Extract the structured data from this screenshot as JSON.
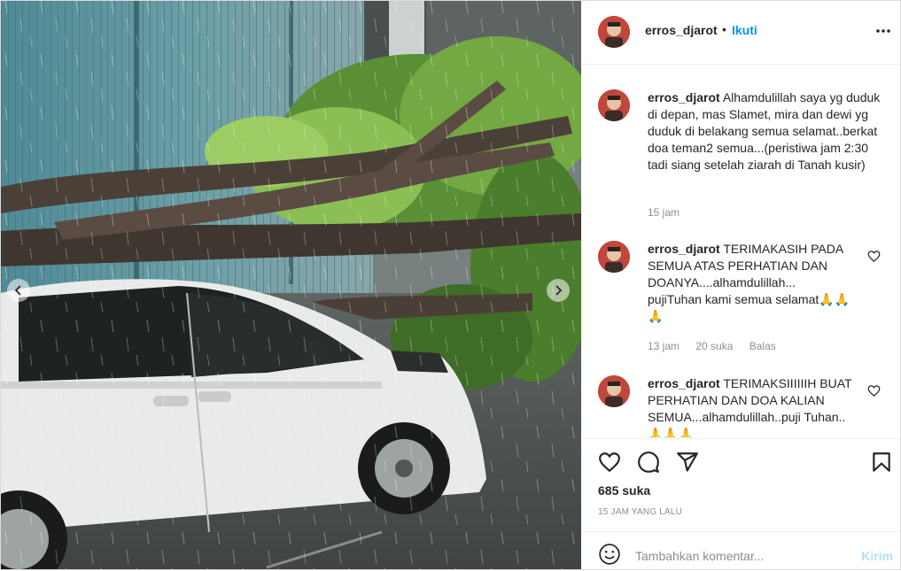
{
  "header": {
    "username": "erros_djarot",
    "separator": "•",
    "follow_label": "Ikuti"
  },
  "icons": {
    "more": "more-horizontal-icon",
    "like": "heart-icon",
    "comment": "comment-icon",
    "share": "paper-plane-icon",
    "save": "bookmark-icon",
    "emoji": "smiley-icon",
    "carousel_prev": "chevron-left-icon",
    "carousel_next": "chevron-right-icon"
  },
  "comments": [
    {
      "username": "erros_djarot",
      "text": "Alhamdulillah saya yg duduk di depan, mas Slamet, mira dan dewi yg duduk di belakang semua selamat..berkat doa teman2 semua...(peristiwa jam 2:30 tadi siang setelah ziarah di Tanah kusir)",
      "time": "15 jam"
    },
    {
      "username": "erros_djarot",
      "text": "TERIMAKASIH PADA SEMUA ATAS PERHATIAN DAN DOANYA....alhamdulillah... pujiTuhan kami semua selamat🙏🙏🙏",
      "time": "13 jam",
      "likes": "20 suka",
      "reply": "Balas"
    },
    {
      "username": "erros_djarot",
      "text": "TERIMAKSIIIIIIH BUAT PERHATIAN DAN DOA KALIAN SEMUA...alhamdulillah..puji Tuhan.. 🙏🙏🙏"
    }
  ],
  "post": {
    "likes": "685 suka",
    "time_ago": "15 JAM YANG LALU"
  },
  "add_comment": {
    "placeholder": "Tambahkan komentar...",
    "post_label": "Kirim"
  },
  "colors": {
    "accent": "#0095f6",
    "post_disabled": "#b2dffc",
    "muted": "#8e8e8e",
    "text": "#262626",
    "border": "#dbdbdb"
  }
}
